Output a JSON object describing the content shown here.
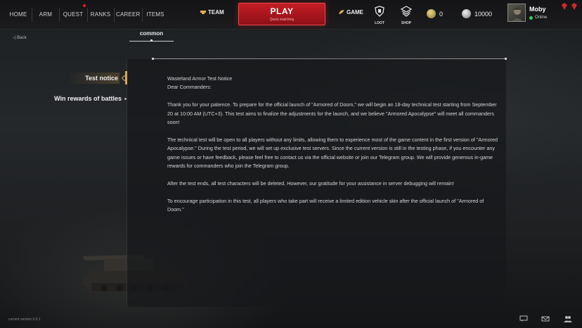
{
  "nav": {
    "home": "HOME",
    "arm": "ARM",
    "quest": "QUEST",
    "ranks": "RANKS",
    "career": "CAREER",
    "items": "ITEMS"
  },
  "team_label": "TEAM",
  "play": {
    "label": "PLAY",
    "sub": "Quick matching"
  },
  "game_label": "GAME",
  "loot_label": "LOOT",
  "shop_label": "SHOP",
  "currency": {
    "gold": "0",
    "silver": "10000"
  },
  "user": {
    "name": "Moby",
    "status": "Online"
  },
  "back_label": "Back",
  "tab_label": "common",
  "sidebar": {
    "items": [
      {
        "label": "Test notice",
        "active": true
      },
      {
        "label": "Win rewards of battles",
        "active": false
      }
    ]
  },
  "notice": {
    "title": "Wasteland Armor Test Notice",
    "greeting": "Dear Commanders:",
    "paragraphs": [
      "Thank you for your patience. To prepare for the official launch of \"Armored of Doom,\" we will begin an 18-day technical test starting from September 20 at 10:00 AM (UTC+3). This test aims to finalize the adjustments for the launch, and we believe \"Armored Apocalypse\" will meet all commanders soon!",
      "The technical test will be open to all players without any limits, allowing them to experience most of the game content in the first version of \"Armored Apocalypse.\" During the test period, we will set up exclusive test servers. Since the current version is still in the testing phase, if you encounter any game issues or have feedback, please feel free to contact us via the official website or join our Telegram group. We will provide generous in-game rewards for commanders who join the Telegram group.",
      "After the test ends, all test characters will be deleted. However, our gratitude for your assistance in server debugging will remain!",
      "To encourage participation in this test, all players who take part will receive a limited edition vehicle skin after the official launch of \"Armored of Doom.\""
    ]
  },
  "version": "current version 0.0.1",
  "colors": {
    "accent_red": "#c41d24",
    "accent_gold": "#d4a853",
    "online_green": "#3ecb4d"
  }
}
